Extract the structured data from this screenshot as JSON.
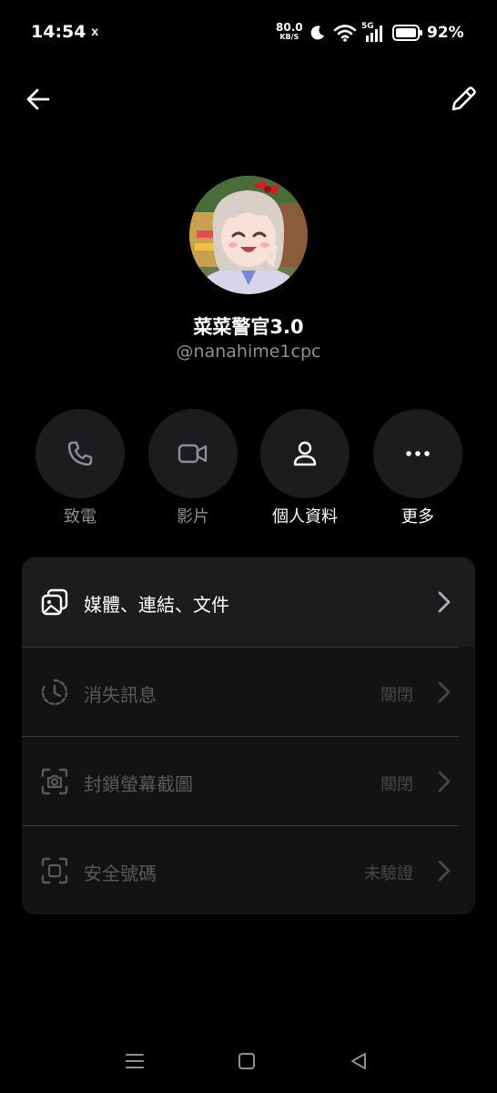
{
  "status_bar": {
    "time": "14:54",
    "notif": "x",
    "net_speed": "80.0",
    "net_speed_unit": "KB/S",
    "signal_label": "5G",
    "battery": "92%"
  },
  "profile": {
    "name": "菜菜警官3.0",
    "handle": "@nanahime1cpc"
  },
  "actions": [
    {
      "label": "致電",
      "icon": "phone-icon",
      "enabled": false
    },
    {
      "label": "影片",
      "icon": "video-icon",
      "enabled": false
    },
    {
      "label": "個人資料",
      "icon": "person-icon",
      "enabled": true
    },
    {
      "label": "更多",
      "icon": "more-icon",
      "enabled": true
    }
  ],
  "menu": [
    {
      "label": "媒體、連結、文件",
      "value": "",
      "icon": "media-icon"
    },
    {
      "label": "消失訊息",
      "value": "關閉",
      "icon": "timer-icon"
    },
    {
      "label": "封鎖螢幕截圖",
      "value": "關閉",
      "icon": "screenshot-icon"
    },
    {
      "label": "安全號碼",
      "value": "未驗證",
      "icon": "scan-icon"
    }
  ],
  "colors": {
    "background": "#000000",
    "card": "#131313",
    "button": "#1c1c1e",
    "muted_text": "#8e8e93"
  }
}
